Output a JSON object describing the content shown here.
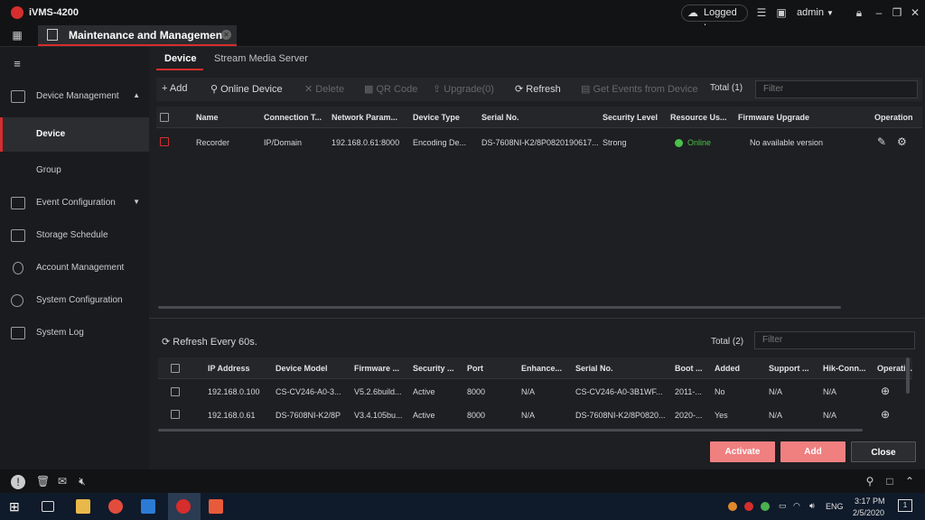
{
  "app": {
    "title": "iVMS-4200",
    "logged_in": "Logged In",
    "user": "admin"
  },
  "main_tab": {
    "label": "Maintenance and Management"
  },
  "sidebar": {
    "device_management": "Device Management",
    "device": "Device",
    "group": "Group",
    "event_configuration": "Event Configuration",
    "storage_schedule": "Storage Schedule",
    "account_management": "Account Management",
    "system_configuration": "System Configuration",
    "system_log": "System Log"
  },
  "subtabs": {
    "device": "Device",
    "stream_media_server": "Stream Media Server"
  },
  "toolbar": {
    "add": "+ Add",
    "online_device": "Online Device",
    "delete": "Delete",
    "qr_code": "QR Code",
    "upgrade": "Upgrade(0)",
    "refresh": "Refresh",
    "get_events": "Get Events from Device",
    "total": "Total (1)",
    "filter_placeholder": "Filter"
  },
  "device_table": {
    "headers": [
      "Name",
      "Connection T...",
      "Network Param...",
      "Device Type",
      "Serial No.",
      "Security Level",
      "Resource Us...",
      "Firmware Upgrade",
      "Operation"
    ],
    "rows": [
      {
        "name": "Recorder",
        "connection": "IP/Domain",
        "network": "192.168.0.61:8000",
        "type": "Encoding De...",
        "serial": "DS-7608NI-K2/8P0820190617...",
        "security": "Strong",
        "resource": "Online",
        "firmware": "No available version"
      }
    ]
  },
  "online_section": {
    "refresh_label": "Refresh Every 60s.",
    "total": "Total (2)",
    "filter_placeholder": "Filter",
    "headers": [
      "IP Address",
      "Device Model",
      "Firmware ...",
      "Security ...",
      "Port",
      "Enhance...",
      "Serial No.",
      "Boot ...",
      "Added",
      "Support ...",
      "Hik-Conn...",
      "Operati..."
    ],
    "rows": [
      {
        "ip": "192.168.0.100",
        "model": "CS-CV246-A0-3...",
        "firmware": "V5.2.6build...",
        "security": "Active",
        "port": "8000",
        "enhance": "N/A",
        "serial": "CS-CV246-A0-3B1WF...",
        "boot": "2011-...",
        "added": "No",
        "support": "N/A",
        "hik": "N/A"
      },
      {
        "ip": "192.168.0.61",
        "model": "DS-7608NI-K2/8P",
        "firmware": "V3.4.105bu...",
        "security": "Active",
        "port": "8000",
        "enhance": "N/A",
        "serial": "DS-7608NI-K2/8P0820...",
        "boot": "2020-...",
        "added": "Yes",
        "support": "N/A",
        "hik": "N/A"
      }
    ]
  },
  "buttons": {
    "activate": "Activate",
    "add": "Add",
    "close": "Close"
  },
  "taskbar": {
    "lang": "ENG",
    "time": "3:17 PM",
    "date": "2/5/2020",
    "notif_count": "1"
  },
  "colors": {
    "accent": "#d62d2d",
    "accent_light": "#f07f80",
    "online": "#4ac24a",
    "bg": "#1e1f22"
  }
}
